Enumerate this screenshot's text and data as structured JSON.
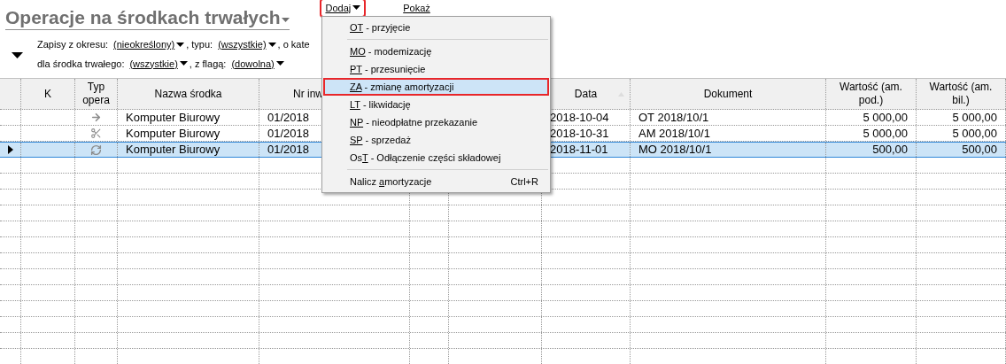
{
  "title": "Operacje na środkach trwałych",
  "toolbar": [
    {
      "label": "Dodaj",
      "dropdown": true,
      "highlighted": true
    },
    {
      "label": "Pokaż",
      "dropdown": false,
      "highlighted": false
    }
  ],
  "filters": [
    [
      {
        "label": "Zapisy z okresu:",
        "value": "(nieokreślony)"
      },
      {
        "label": ", typu:",
        "value": "(wszystkie)"
      },
      {
        "label": ", o kate"
      }
    ],
    [
      {
        "label": "dla środka trwałego:",
        "value": "(wszystkie)"
      },
      {
        "label": ", z flagą:",
        "value": "(dowolna)"
      }
    ]
  ],
  "table": {
    "columns": [
      {
        "label": "K"
      },
      {
        "label": "Typ opera"
      },
      {
        "label": "Nazwa środka"
      },
      {
        "label": "Nr inw"
      },
      {},
      {},
      {
        "label": "Data",
        "sorted": true
      },
      {
        "label": "Dokument"
      },
      {
        "label": "Wartość (am. pod.)"
      },
      {
        "label": "Wartość (am. bil.)"
      }
    ],
    "rows": [
      {
        "selected": false,
        "kind": "arrow",
        "cells": [
          null,
          null,
          "Komputer Biurowy",
          "01/2018",
          null,
          null,
          "2018-10-04",
          "OT 2018/10/1",
          "5 000,00",
          "5 000,00"
        ]
      },
      {
        "selected": false,
        "kind": "scissors",
        "cells": [
          null,
          null,
          "Komputer Biurowy",
          "01/2018",
          null,
          null,
          "2018-10-31",
          "AM 2018/10/1",
          "5 000,00",
          "5 000,00"
        ]
      },
      {
        "selected": true,
        "kind": "refresh",
        "cells": [
          null,
          null,
          "Komputer Biurowy",
          "01/2018",
          null,
          null,
          "2018-11-01",
          "MO 2018/10/1",
          "500,00",
          "500,00"
        ]
      }
    ]
  },
  "menu": [
    {
      "kind": "item",
      "key": "OT",
      "rest": " - przyjęcie",
      "selected": false
    },
    {
      "kind": "separator"
    },
    {
      "kind": "item",
      "key": "MO",
      "rest": " - modemizację",
      "selected": false
    },
    {
      "kind": "item",
      "key": "PT",
      "rest": " - przesunięcie",
      "selected": false
    },
    {
      "kind": "item",
      "key": "ZA",
      "rest": " - zmianę amortyzacji",
      "selected": true
    },
    {
      "kind": "item",
      "key": "LT",
      "rest": " - likwidację",
      "selected": false
    },
    {
      "kind": "item",
      "key": "NP",
      "rest": " - nieodpłatne przekazanie",
      "selected": false
    },
    {
      "kind": "item",
      "key": "SP",
      "rest": " - sprzedaż",
      "selected": false
    },
    {
      "kind": "item",
      "prefix": "Os",
      "key": "T",
      "rest": " - Odłączenie części składowej",
      "selected": false
    },
    {
      "kind": "separator"
    },
    {
      "kind": "item",
      "prefix": "Nalicz ",
      "key": "a",
      "rest": "mortyzacje",
      "shortcut": "Ctrl+R",
      "selected": false
    }
  ]
}
